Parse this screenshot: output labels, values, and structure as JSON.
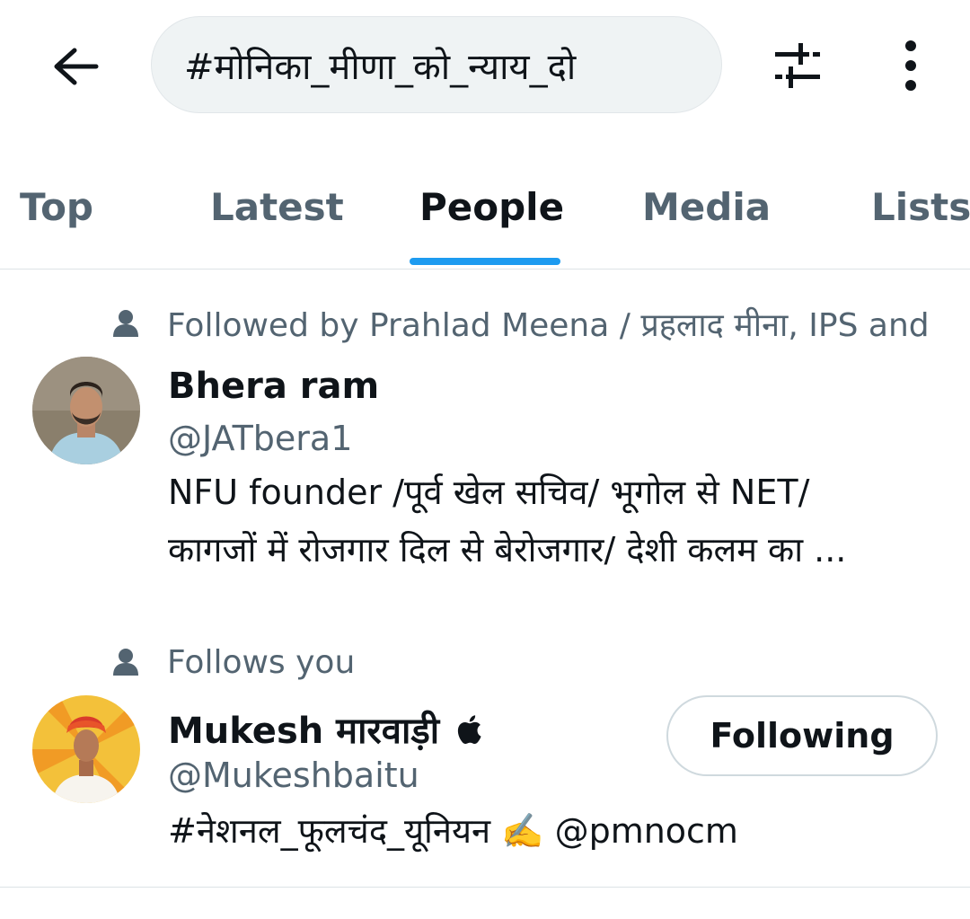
{
  "search": {
    "query": "#मोनिका_मीणा_को_न्याय_दो"
  },
  "tabs": [
    {
      "label": "Top"
    },
    {
      "label": "Latest"
    },
    {
      "label": "People"
    },
    {
      "label": "Media"
    },
    {
      "label": "Lists"
    }
  ],
  "active_tab": "People",
  "colors": {
    "accent": "#1d9bf0",
    "secondary_text": "#536471",
    "primary_text": "#0f1419"
  },
  "users": [
    {
      "context": "Followed by Prahlad Meena / प्रहलाद मीना, IPS and",
      "name": "Bhera ram",
      "handle": "@JATbera1",
      "bio_lines": [
        "NFU founder /पूर्व खेल सचिव/ भूगोल से NET/",
        "कागजों में रोजगार दिल से बेरोजगार/ देशी कलम का ..."
      ]
    },
    {
      "context": "Follows you",
      "name": "Mukesh मारवाड़ी",
      "name_badge": "",
      "handle": "@Mukeshbaitu",
      "bio": "#नेशनल_फूलचंद_यूनियन ✍️ @pmnocm",
      "follow_button": "Following"
    }
  ]
}
